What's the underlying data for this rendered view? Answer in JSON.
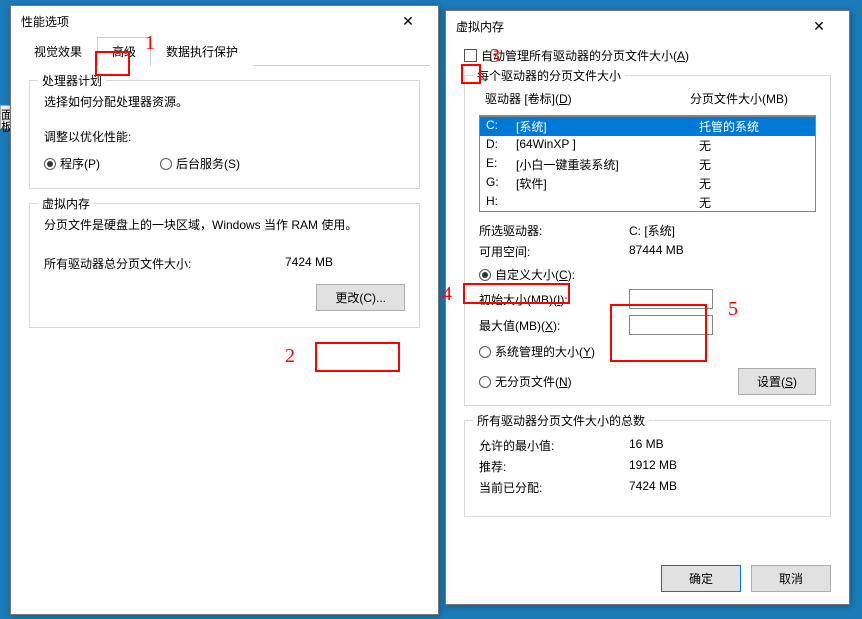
{
  "taskbar_hint": "面板",
  "left": {
    "title": "性能选项",
    "tabs": [
      "视觉效果",
      "高级",
      "数据执行保护"
    ],
    "processor": {
      "legend": "处理器计划",
      "desc": "选择如何分配处理器资源。",
      "adjust_label": "调整以优化性能:",
      "r1": "程序(P)",
      "r2": "后台服务(S)"
    },
    "vm": {
      "legend": "虚拟内存",
      "desc": "分页文件是硬盘上的一块区域，Windows 当作 RAM 使用。",
      "total_label": "所有驱动器总分页文件大小:",
      "total_value": "7424 MB",
      "change_btn": "更改(C)..."
    }
  },
  "right": {
    "title": "虚拟内存",
    "auto_label_pre": "自",
    "auto_label": "动管理所有驱动器的分页文件大小(",
    "auto_label_u": "A",
    "auto_label_post": ")",
    "each_legend": "每个驱动器的分页文件大小",
    "header_drive": "驱动器 [卷标](",
    "header_drive_u": "D",
    "header_drive_post": ")",
    "header_size": "分页文件大小(MB)",
    "drives": [
      {
        "d": "C:",
        "l": "[系统]",
        "s": "托管的系统"
      },
      {
        "d": "D:",
        "l": "[64WinXP ]",
        "s": "无"
      },
      {
        "d": "E:",
        "l": "[小白一键重装系统]",
        "s": "无"
      },
      {
        "d": "G:",
        "l": "[软件]",
        "s": "无"
      },
      {
        "d": "H:",
        "l": "",
        "s": "无"
      }
    ],
    "selected_drive_label": "所选驱动器:",
    "selected_drive_value": "C:  [系统]",
    "avail_label": "可用空间:",
    "avail_value": "87444 MB",
    "custom_radio_pre": "自",
    "custom_radio": "定义大小(",
    "custom_radio_u": "C",
    "custom_radio_post": "):",
    "initial_label": "初始大小(MB)(",
    "initial_u": "I",
    "initial_post": "):",
    "max_label": "最大值(MB)(",
    "max_u": "X",
    "max_post": "):",
    "system_radio": "系统管理的大小(",
    "system_u": "Y",
    "system_post": ")",
    "nopage_radio": "无分页文件(",
    "nopage_u": "N",
    "nopage_post": ")",
    "set_btn": "设置(",
    "set_u": "S",
    "set_post": ")",
    "totals_legend": "所有驱动器分页文件大小的总数",
    "min_label": "允许的最小值:",
    "min_value": "16 MB",
    "rec_label": "推荐:",
    "rec_value": "1912 MB",
    "cur_label": "当前已分配:",
    "cur_value": "7424 MB",
    "ok_btn": "确定",
    "cancel_btn": "取消"
  },
  "callouts": {
    "n1": "1",
    "n2": "2",
    "n3": "3",
    "n4": "4",
    "n5": "5"
  }
}
